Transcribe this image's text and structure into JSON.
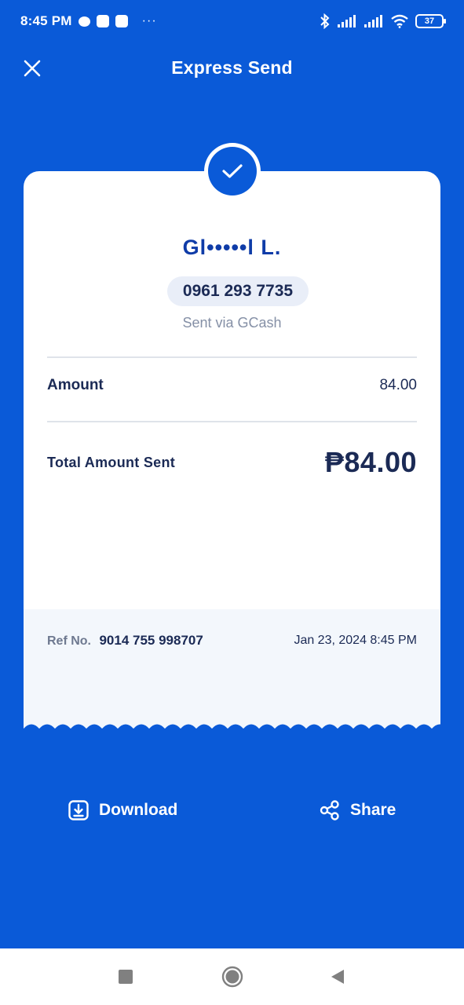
{
  "status_bar": {
    "time": "8:45 PM",
    "more": "···",
    "battery": "37"
  },
  "header": {
    "title": "Express Send"
  },
  "receipt": {
    "recipient_name": "Gl•••••l L.",
    "phone": "0961 293 7735",
    "sent_via": "Sent via GCash",
    "amount_label": "Amount",
    "amount_value": "84.00",
    "total_label": "Total Amount Sent",
    "total_value": "₱84.00",
    "ref_label": "Ref No.",
    "ref_number": "9014 755 998707",
    "date": "Jan 23, 2024 8:45 PM"
  },
  "actions": {
    "download_label": "Download",
    "share_label": "Share"
  },
  "colors": {
    "brand_blue": "#0a5ad8",
    "text_dark": "#1b2a55",
    "name_blue": "#0f3ca8"
  },
  "icons": {
    "close": "close-icon",
    "check": "check-icon",
    "download": "download-icon",
    "share": "share-icon"
  }
}
